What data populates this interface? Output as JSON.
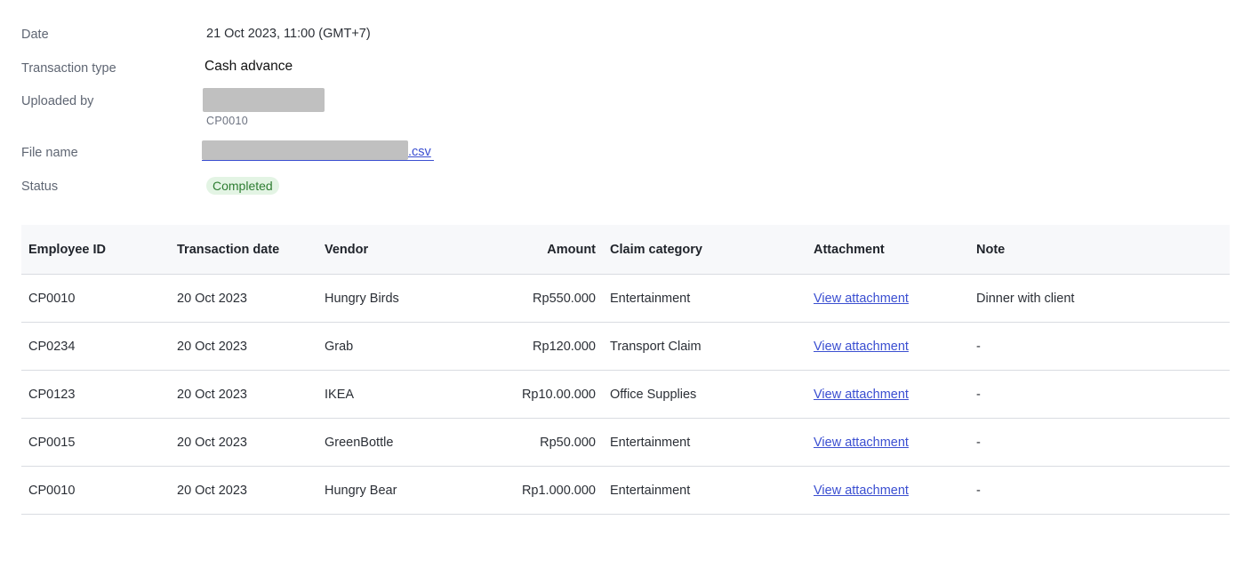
{
  "details": {
    "date": {
      "label": "Date",
      "value": "21 Oct 2023, 11:00 (GMT+7)"
    },
    "transaction_type": {
      "label": "Transaction type",
      "value": "Cash advance"
    },
    "uploaded_by": {
      "label": "Uploaded by",
      "id": "CP0010"
    },
    "file_name": {
      "label": "File name",
      "extension": ".csv"
    },
    "status": {
      "label": "Status",
      "value": "Completed",
      "color": "#2e7d32",
      "background": "#e3f4e4"
    }
  },
  "table": {
    "headers": [
      "Employee ID",
      "Transaction date",
      "Vendor",
      "Amount",
      "Claim category",
      "Attachment",
      "Note"
    ],
    "rows": [
      [
        "CP0010",
        "20 Oct 2023",
        "Hungry Birds",
        "Rp550.000",
        "Entertainment",
        "View attachment",
        "Dinner with client"
      ],
      [
        "CP0234",
        "20 Oct 2023",
        "Grab",
        "Rp120.000",
        "Transport Claim",
        "View attachment",
        "-"
      ],
      [
        "CP0123",
        "20 Oct 2023",
        "IKEA",
        "Rp10.00.000",
        "Office Supplies",
        "View attachment",
        "-"
      ],
      [
        "CP0015",
        "20 Oct 2023",
        "GreenBottle",
        "Rp50.000",
        "Entertainment",
        "View attachment",
        "-"
      ],
      [
        "CP0010",
        "20 Oct 2023",
        "Hungry Bear",
        "Rp1.000.000",
        "Entertainment",
        "View attachment",
        "-"
      ]
    ]
  },
  "colors": {
    "link": "#3b4fd1",
    "header_bg": "#f7f8fa",
    "redaction": "#c0c0c0"
  }
}
